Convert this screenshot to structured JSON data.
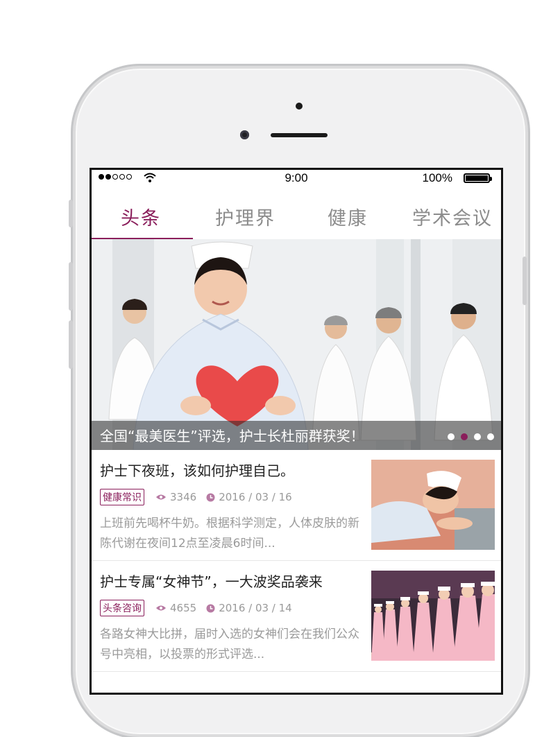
{
  "status_bar": {
    "time": "9:00",
    "battery": "100%"
  },
  "tabs": [
    {
      "label": "头条",
      "active": true
    },
    {
      "label": "护理界",
      "active": false
    },
    {
      "label": "健康",
      "active": false
    },
    {
      "label": "学术会议",
      "active": false
    }
  ],
  "banner": {
    "caption": "全国“最美医生”评选，护士长杜丽群获奖！",
    "slide_count": 4,
    "active_slide": 2
  },
  "news": [
    {
      "title": "护士下夜班，该如何护理自己。",
      "tag": "健康常识",
      "views": "3346",
      "date": "2016 / 03 / 16",
      "summary": "上班前先喝杯牛奶。根据科学测定，人体皮肤的新陈代谢在夜间12点至凌晨6时间..."
    },
    {
      "title": "护士专属“女神节”，一大波奖品袭来",
      "tag": "头条咨询",
      "views": "4655",
      "date": "2016 / 03 / 14",
      "summary": "各路女神大比拼，届时入选的女神们会在我们公众号中亮相，以投票的形式评选..."
    }
  ],
  "colors": {
    "accent": "#8a1e5b",
    "tab_inactive": "#8c8c8c",
    "meta_text": "#9a9a9a"
  },
  "icons": {
    "views": "eye-icon",
    "date": "clock-icon"
  }
}
